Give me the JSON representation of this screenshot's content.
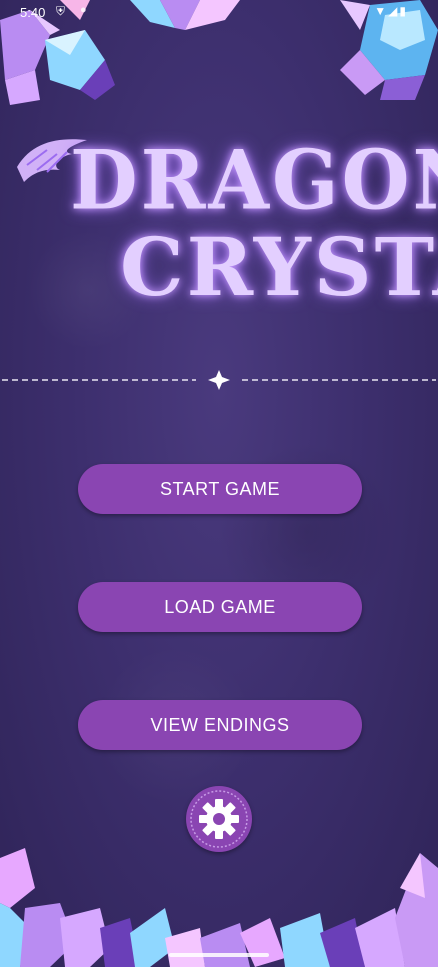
{
  "status_bar": {
    "time": "5:40",
    "shield_icon": "shield-icon",
    "right_icons": "wifi-icon signal-icon battery-icon"
  },
  "title": {
    "line1": "DRAGONS",
    "line2": "CRYSTAL",
    "glow_color": "#c89bff",
    "text_color": "#e3cfff"
  },
  "menu": {
    "start_label": "START GAME",
    "load_label": "LOAD GAME",
    "endings_label": "VIEW ENDINGS",
    "settings_icon": "gear-icon"
  },
  "colors": {
    "background": "#3d2f6e",
    "button": "#8a45b2",
    "button_text": "#ffffff"
  }
}
